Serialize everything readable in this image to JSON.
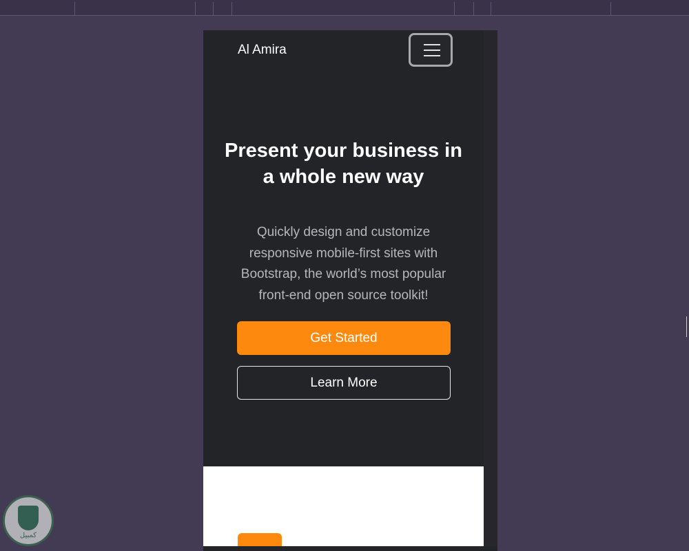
{
  "navbar": {
    "brand": "Al Amira",
    "toggler_icon": "hamburger-menu-icon"
  },
  "hero": {
    "title": "Present your business in a whole new way",
    "text": "Quickly design and customize responsive mobile-first sites with Bootstrap, the world’s most popular front-end open source toolkit!",
    "primary_button": "Get Started",
    "secondary_button": "Learn More"
  },
  "colors": {
    "background": "#433a54",
    "hero_background": "#232428",
    "accent": "#fd8a0f",
    "text_light": "#ffffff",
    "text_muted": "#b7b7b9"
  },
  "watermark": {
    "text": "كمبيل",
    "icon": "shield-icon"
  }
}
